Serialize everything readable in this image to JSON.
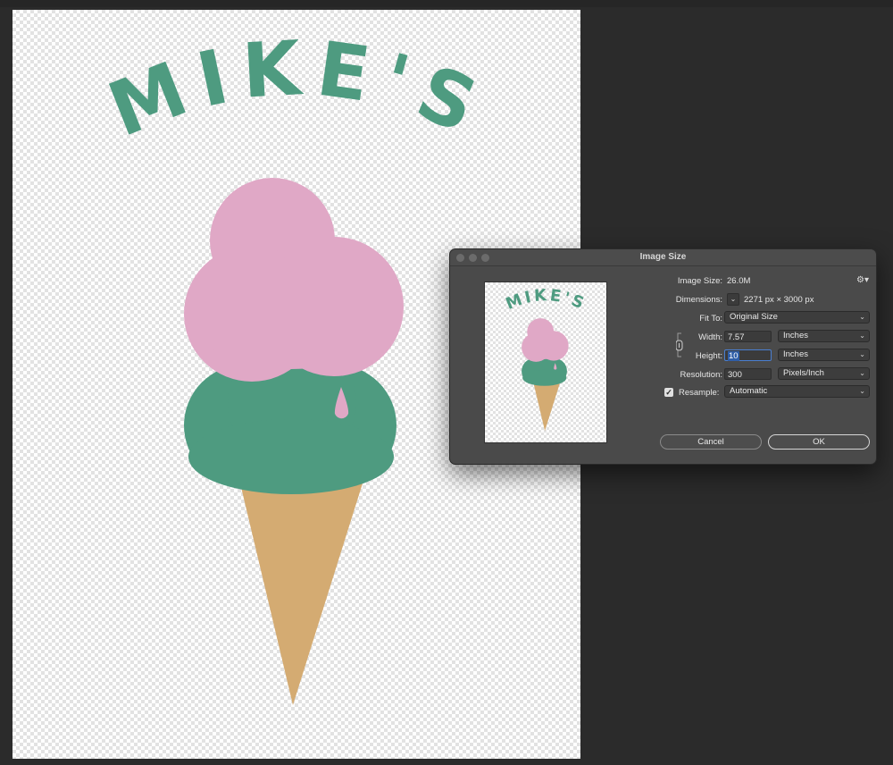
{
  "canvas": {
    "artwork_text": "MIKE'S",
    "colors": {
      "pink": "#e0a8c6",
      "green": "#4e9b80",
      "cone": "#d4ab72"
    }
  },
  "dialog": {
    "title": "Image Size",
    "image_size_label": "Image Size:",
    "image_size_value": "26.0M",
    "dimensions_label": "Dimensions:",
    "dimensions_value": "2271 px  ×  3000 px",
    "fit_to_label": "Fit To:",
    "fit_to_value": "Original Size",
    "width_label": "Width:",
    "width_value": "7.57",
    "width_unit": "Inches",
    "height_label": "Height:",
    "height_value": "10",
    "height_unit": "Inches",
    "resolution_label": "Resolution:",
    "resolution_value": "300",
    "resolution_unit": "Pixels/Inch",
    "resample_label": "Resample:",
    "resample_checked": true,
    "resample_value": "Automatic",
    "cancel_label": "Cancel",
    "ok_label": "OK",
    "icons": {
      "gear": "gear-icon",
      "link": "link-icon",
      "chevron": "chevron-down-icon"
    }
  }
}
